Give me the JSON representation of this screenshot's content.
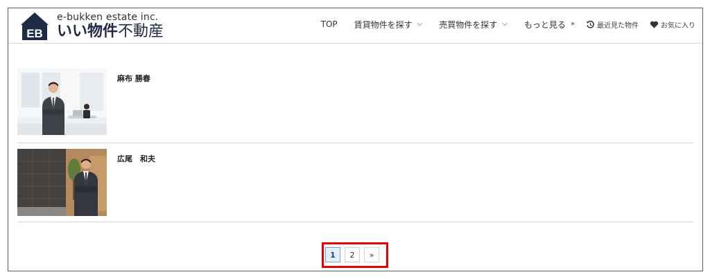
{
  "header": {
    "logo": {
      "mark_text": "EB",
      "subtitle": "e-bukken estate inc.",
      "title_bold": "いい物件",
      "title_rest": "不動産"
    },
    "nav": [
      {
        "label": "TOP"
      },
      {
        "label": "賃貸物件を探す"
      },
      {
        "label": "売買物件を探す"
      },
      {
        "label": "もっと見る"
      },
      {
        "label": "最近見た物件"
      },
      {
        "label": "お気に入り"
      }
    ]
  },
  "agents": [
    {
      "name": "麻布 勝春"
    },
    {
      "name": "広尾　和夫"
    }
  ],
  "pagination": {
    "pages": [
      "1",
      "2"
    ],
    "current": "1",
    "next_label": "»"
  },
  "colors": {
    "brand_navy": "#1f2a44",
    "highlight_red": "#e60000",
    "active_page_bg": "#e7f0ff"
  }
}
